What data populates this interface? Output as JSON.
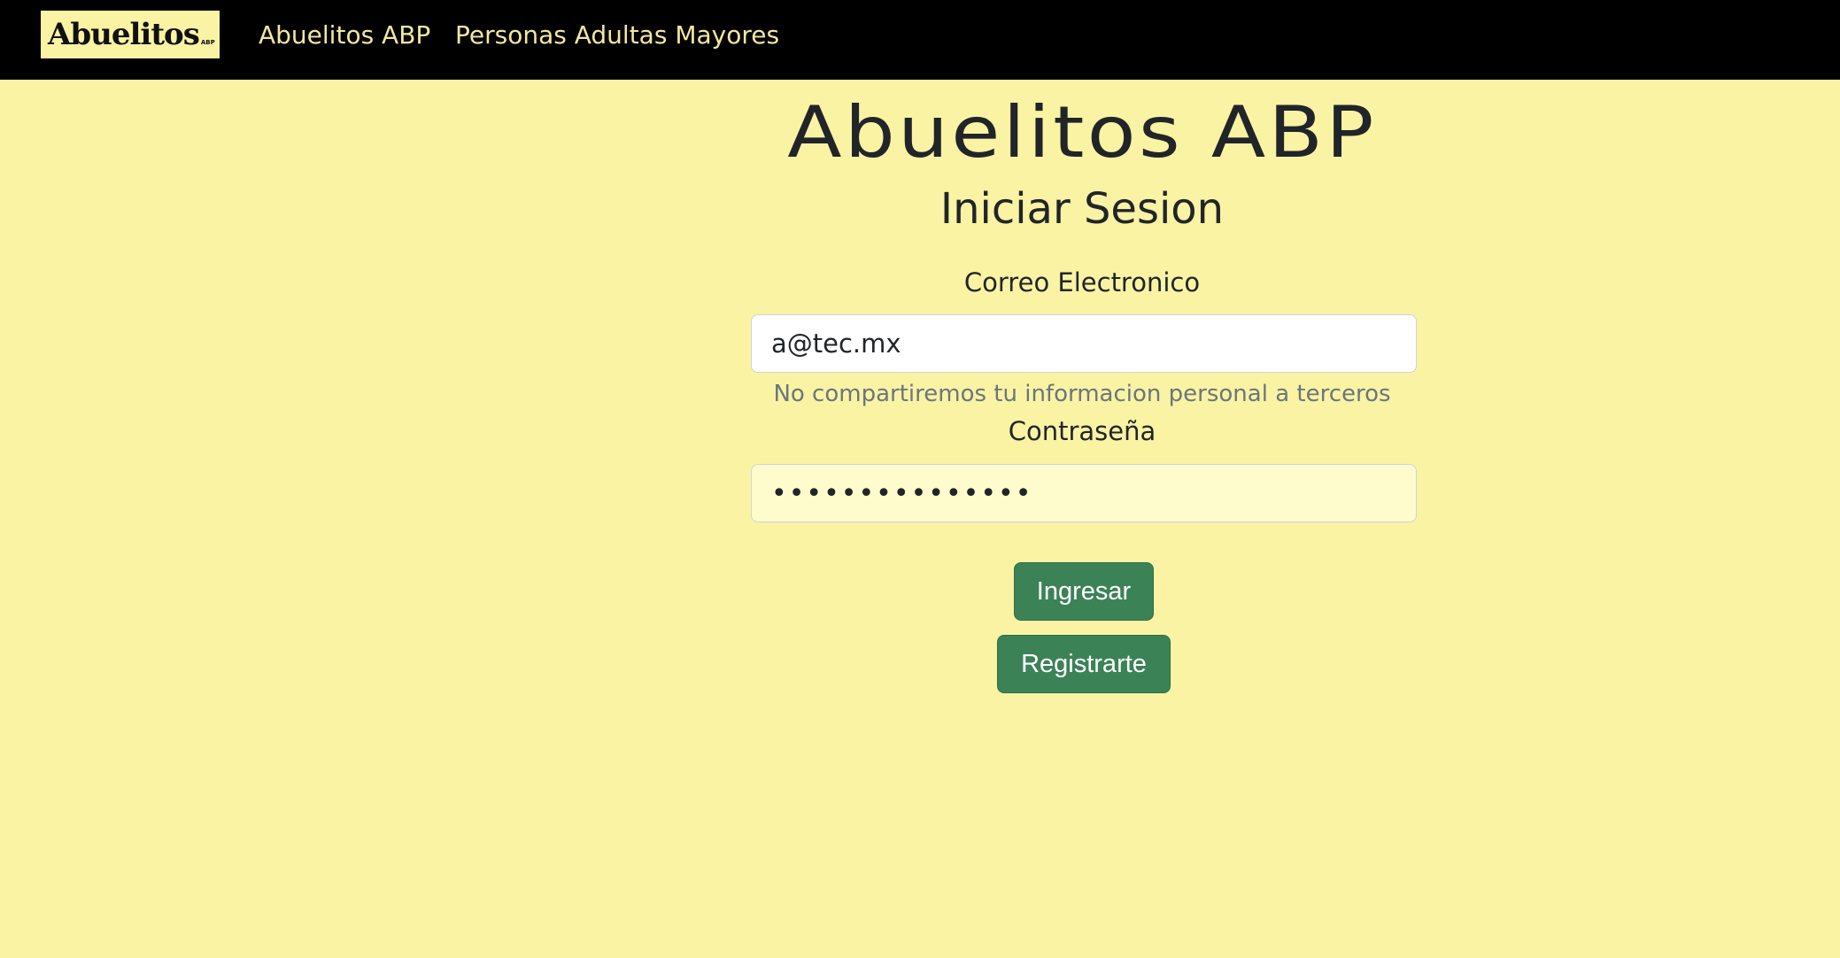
{
  "navbar": {
    "logo_text": "Abuelitos",
    "logo_subtext": "ABP",
    "links": [
      {
        "label": "Abuelitos ABP"
      },
      {
        "label": "Personas Adultas Mayores"
      }
    ]
  },
  "main": {
    "site_title": "Abuelitos ABP",
    "heading": "Iniciar Sesion",
    "email": {
      "label": "Correo Electronico",
      "value": "a@tec.mx",
      "help": "No compartiremos tu informacion personal a terceros"
    },
    "password": {
      "label": "Contraseña",
      "masked_value": "•••••••••••••••"
    },
    "buttons": {
      "login": "Ingresar",
      "register": "Registrarte"
    }
  },
  "colors": {
    "navbar_bg": "#000000",
    "page_bg": "#FAF3A3",
    "button_bg": "#3C8257",
    "nav_link": "#F2E7A0"
  }
}
